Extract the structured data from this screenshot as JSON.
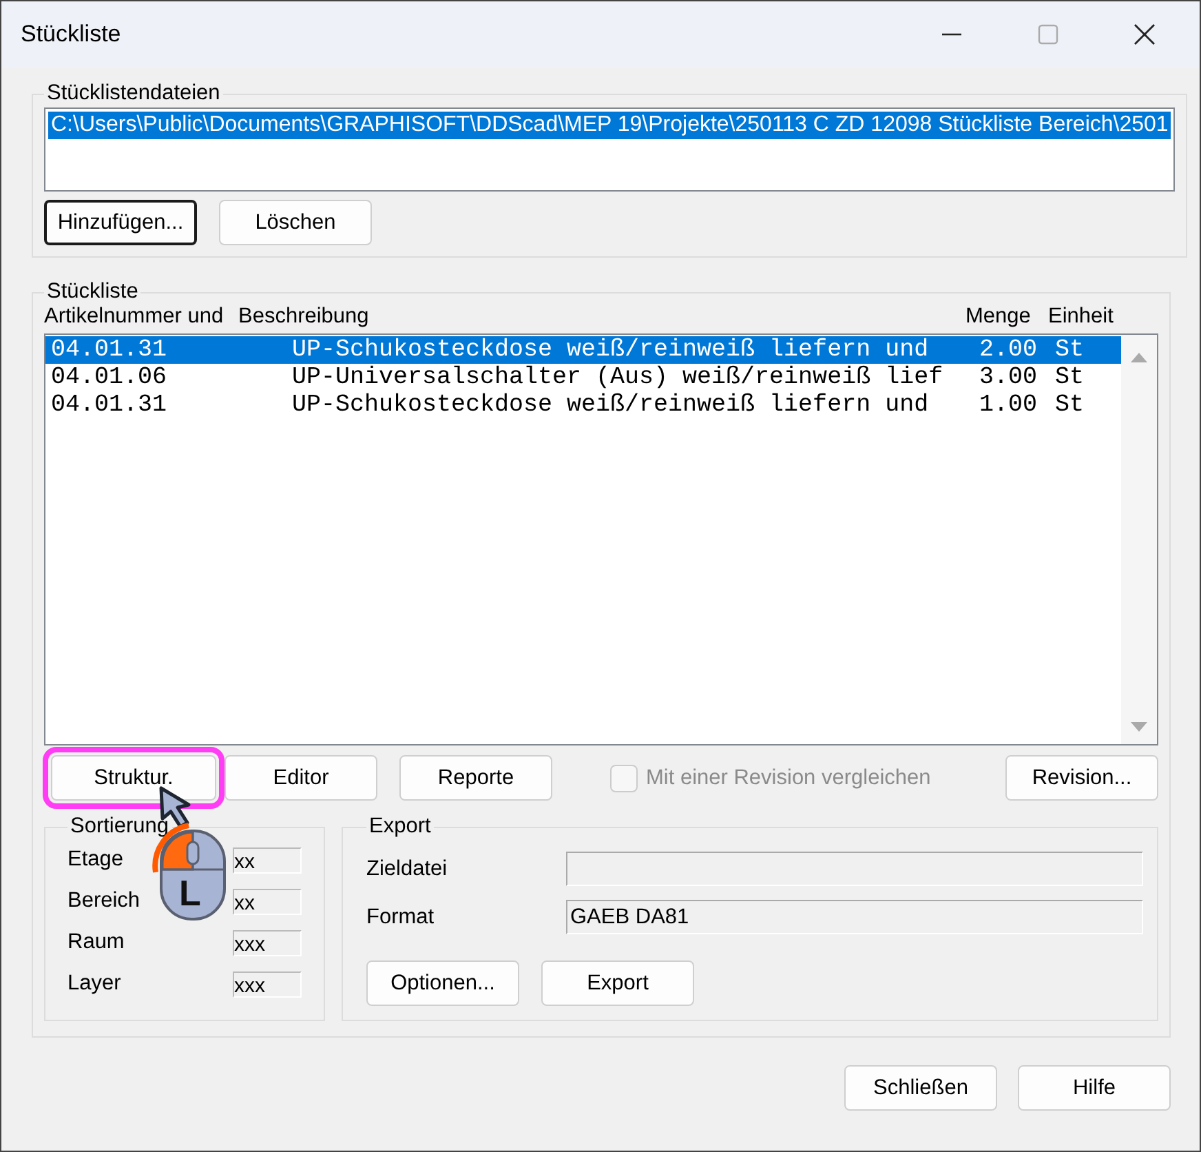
{
  "window": {
    "title": "Stückliste"
  },
  "files_group": {
    "label": "Stücklistendateien",
    "files": [
      {
        "path": "C:\\Users\\Public\\Documents\\GRAPHISOFT\\DDScad\\MEP 19\\Projekte\\250113 C ZD 12098 Stückliste Bereich\\2501",
        "selected": true
      }
    ],
    "buttons": [
      {
        "label": "Hinzufügen...",
        "focused": true
      },
      {
        "label": "Löschen",
        "focused": false
      }
    ]
  },
  "list_group": {
    "label": "Stückliste",
    "columns": [
      "Artikelnummer und",
      "Beschreibung",
      "Menge",
      "Einheit"
    ],
    "rows": [
      {
        "cells": [
          "04.01.31",
          "UP-Schukosteckdose weiß/reinweiß liefern und",
          "2.00",
          "St"
        ],
        "selected": true
      },
      {
        "cells": [
          "04.01.06",
          "UP-Universalschalter (Aus) weiß/reinweiß lief",
          "3.00",
          "St"
        ],
        "selected": false
      },
      {
        "cells": [
          "04.01.31",
          "UP-Schukosteckdose weiß/reinweiß liefern und",
          "1.00",
          "St"
        ],
        "selected": false
      }
    ]
  },
  "action_buttons": [
    {
      "label": "Struktur.",
      "highlighted": true
    },
    {
      "label": "Editor",
      "highlighted": false
    },
    {
      "label": "Reporte",
      "highlighted": false
    }
  ],
  "compare_checkbox": {
    "label": "Mit einer Revision vergleichen",
    "checked": false,
    "disabled": true
  },
  "revision_button": {
    "label": "Revision..."
  },
  "sorting": {
    "label": "Sortierung",
    "fields": [
      {
        "label": "Etage",
        "value": "xx"
      },
      {
        "label": "Bereich",
        "value": "xx"
      },
      {
        "label": "Raum",
        "value": "xxx"
      },
      {
        "label": "Layer",
        "value": "xxx"
      }
    ]
  },
  "export": {
    "label": "Export",
    "fields": [
      {
        "label": "Zieldatei"
      },
      {
        "label": "Format",
        "value": "GAEB DA81"
      }
    ],
    "buttons": [
      {
        "label": "Optionen..."
      },
      {
        "label": "Export"
      }
    ]
  },
  "footer_buttons": [
    {
      "label": "Schließen"
    },
    {
      "label": "Hilfe"
    }
  ],
  "annotation": {
    "mouse_button": "L"
  }
}
